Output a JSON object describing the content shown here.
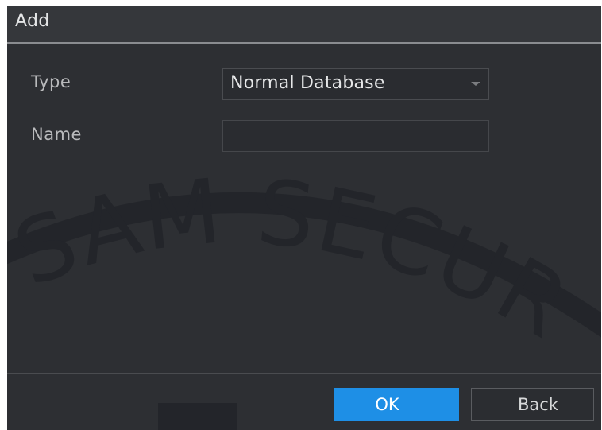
{
  "dialog": {
    "title": "Add"
  },
  "form": {
    "type_label": "Type",
    "type_value": "Normal Database",
    "name_label": "Name",
    "name_value": ""
  },
  "buttons": {
    "ok_label": "OK",
    "back_label": "Back"
  },
  "watermark": {
    "text": "SAM SECUR"
  },
  "colors": {
    "dialog_bg": "#2d2f33",
    "primary_button": "#1e8fe6",
    "text": "#e6e7e8",
    "label": "#b9babc"
  }
}
